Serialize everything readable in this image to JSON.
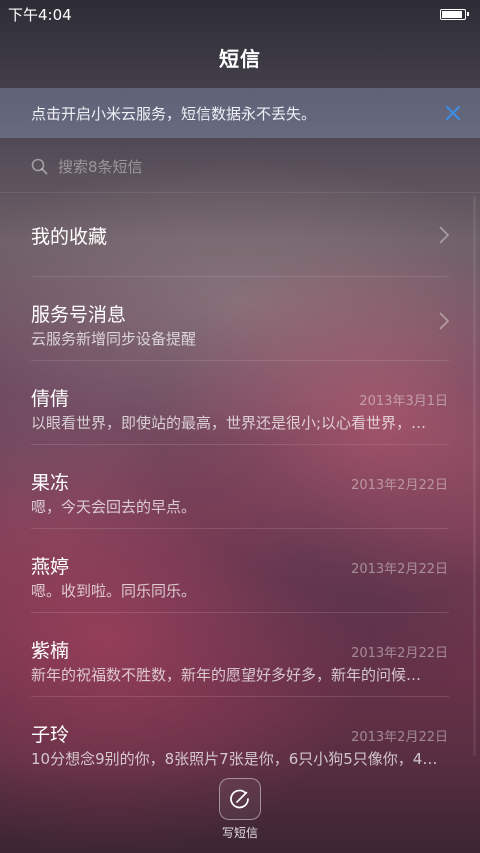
{
  "status_bar": {
    "time": "下午4:04",
    "battery_level": 1.0
  },
  "header": {
    "title": "短信"
  },
  "banner": {
    "text": "点击开启小米云服务，短信数据永不丢失。",
    "close_icon": "close-icon",
    "accent": "#3a8ee6"
  },
  "search": {
    "placeholder": "搜索8条短信",
    "icon": "search-icon"
  },
  "items": [
    {
      "name": "我的收藏",
      "sub": "",
      "date": "",
      "chevron": true
    },
    {
      "name": "服务号消息",
      "sub": "云服务新增同步设备提醒",
      "date": "",
      "chevron": true
    },
    {
      "name": "倩倩",
      "sub": "以眼看世界，即使站的最高，世界还是很小;以心看世界，…",
      "date": "2013年3月1日",
      "chevron": false
    },
    {
      "name": "果冻",
      "sub": "嗯，今天会回去的早点。",
      "date": "2013年2月22日",
      "chevron": false
    },
    {
      "name": "燕婷",
      "sub": "嗯。收到啦。同乐同乐。",
      "date": "2013年2月22日",
      "chevron": false
    },
    {
      "name": "紫楠",
      "sub": "新年的祝福数不胜数，新年的愿望好多好多，新年的问候…",
      "date": "2013年2月22日",
      "chevron": false
    },
    {
      "name": "子玲",
      "sub": "10分想念9别的你，8张照片7张是你，6只小狗5只像你，4…",
      "date": "2013年2月22日",
      "chevron": false
    }
  ],
  "compose": {
    "label": "写短信",
    "icon": "compose-icon"
  }
}
